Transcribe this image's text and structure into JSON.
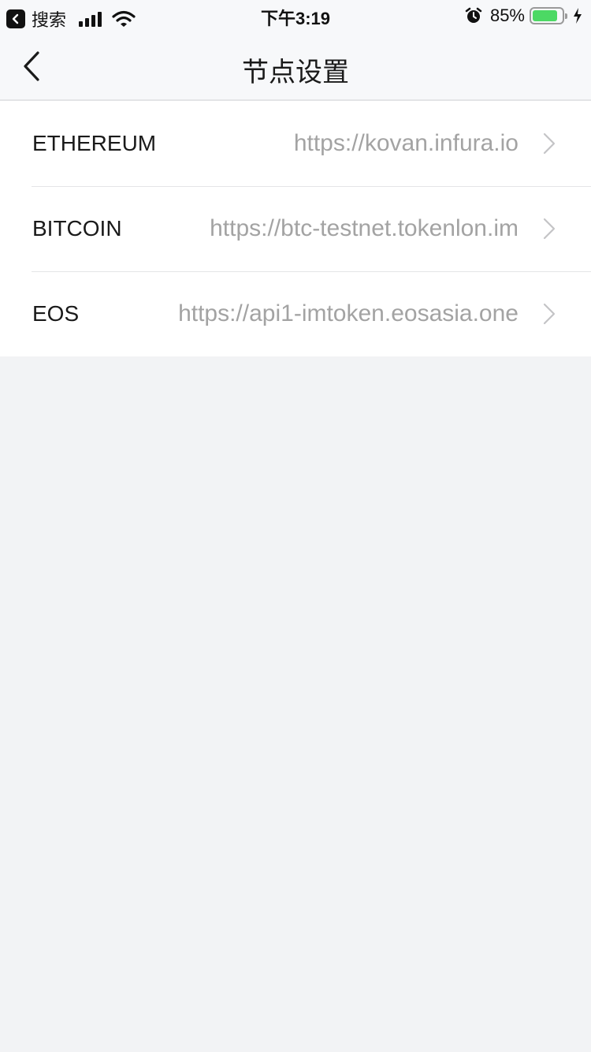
{
  "status_bar": {
    "back_app_label": "搜索",
    "time": "下午3:19",
    "battery_percent": "85%",
    "battery_level": 0.85,
    "signal_bars": 4,
    "icons": [
      "back-app-icon",
      "signal-icon",
      "wifi-icon",
      "alarm-icon",
      "battery-icon",
      "charging-icon"
    ]
  },
  "nav": {
    "title": "节点设置",
    "back_icon": "chevron-left-icon"
  },
  "nodes": [
    {
      "label": "ETHEREUM",
      "url": "https://kovan.infura.io"
    },
    {
      "label": "BITCOIN",
      "url": "https://btc-testnet.tokenlon.im"
    },
    {
      "label": "EOS",
      "url": "https://api1-imtoken.eosasia.one"
    }
  ],
  "colors": {
    "battery_green": "#4cd964",
    "url_gray": "#a3a3a3",
    "background": "#f2f3f5"
  }
}
